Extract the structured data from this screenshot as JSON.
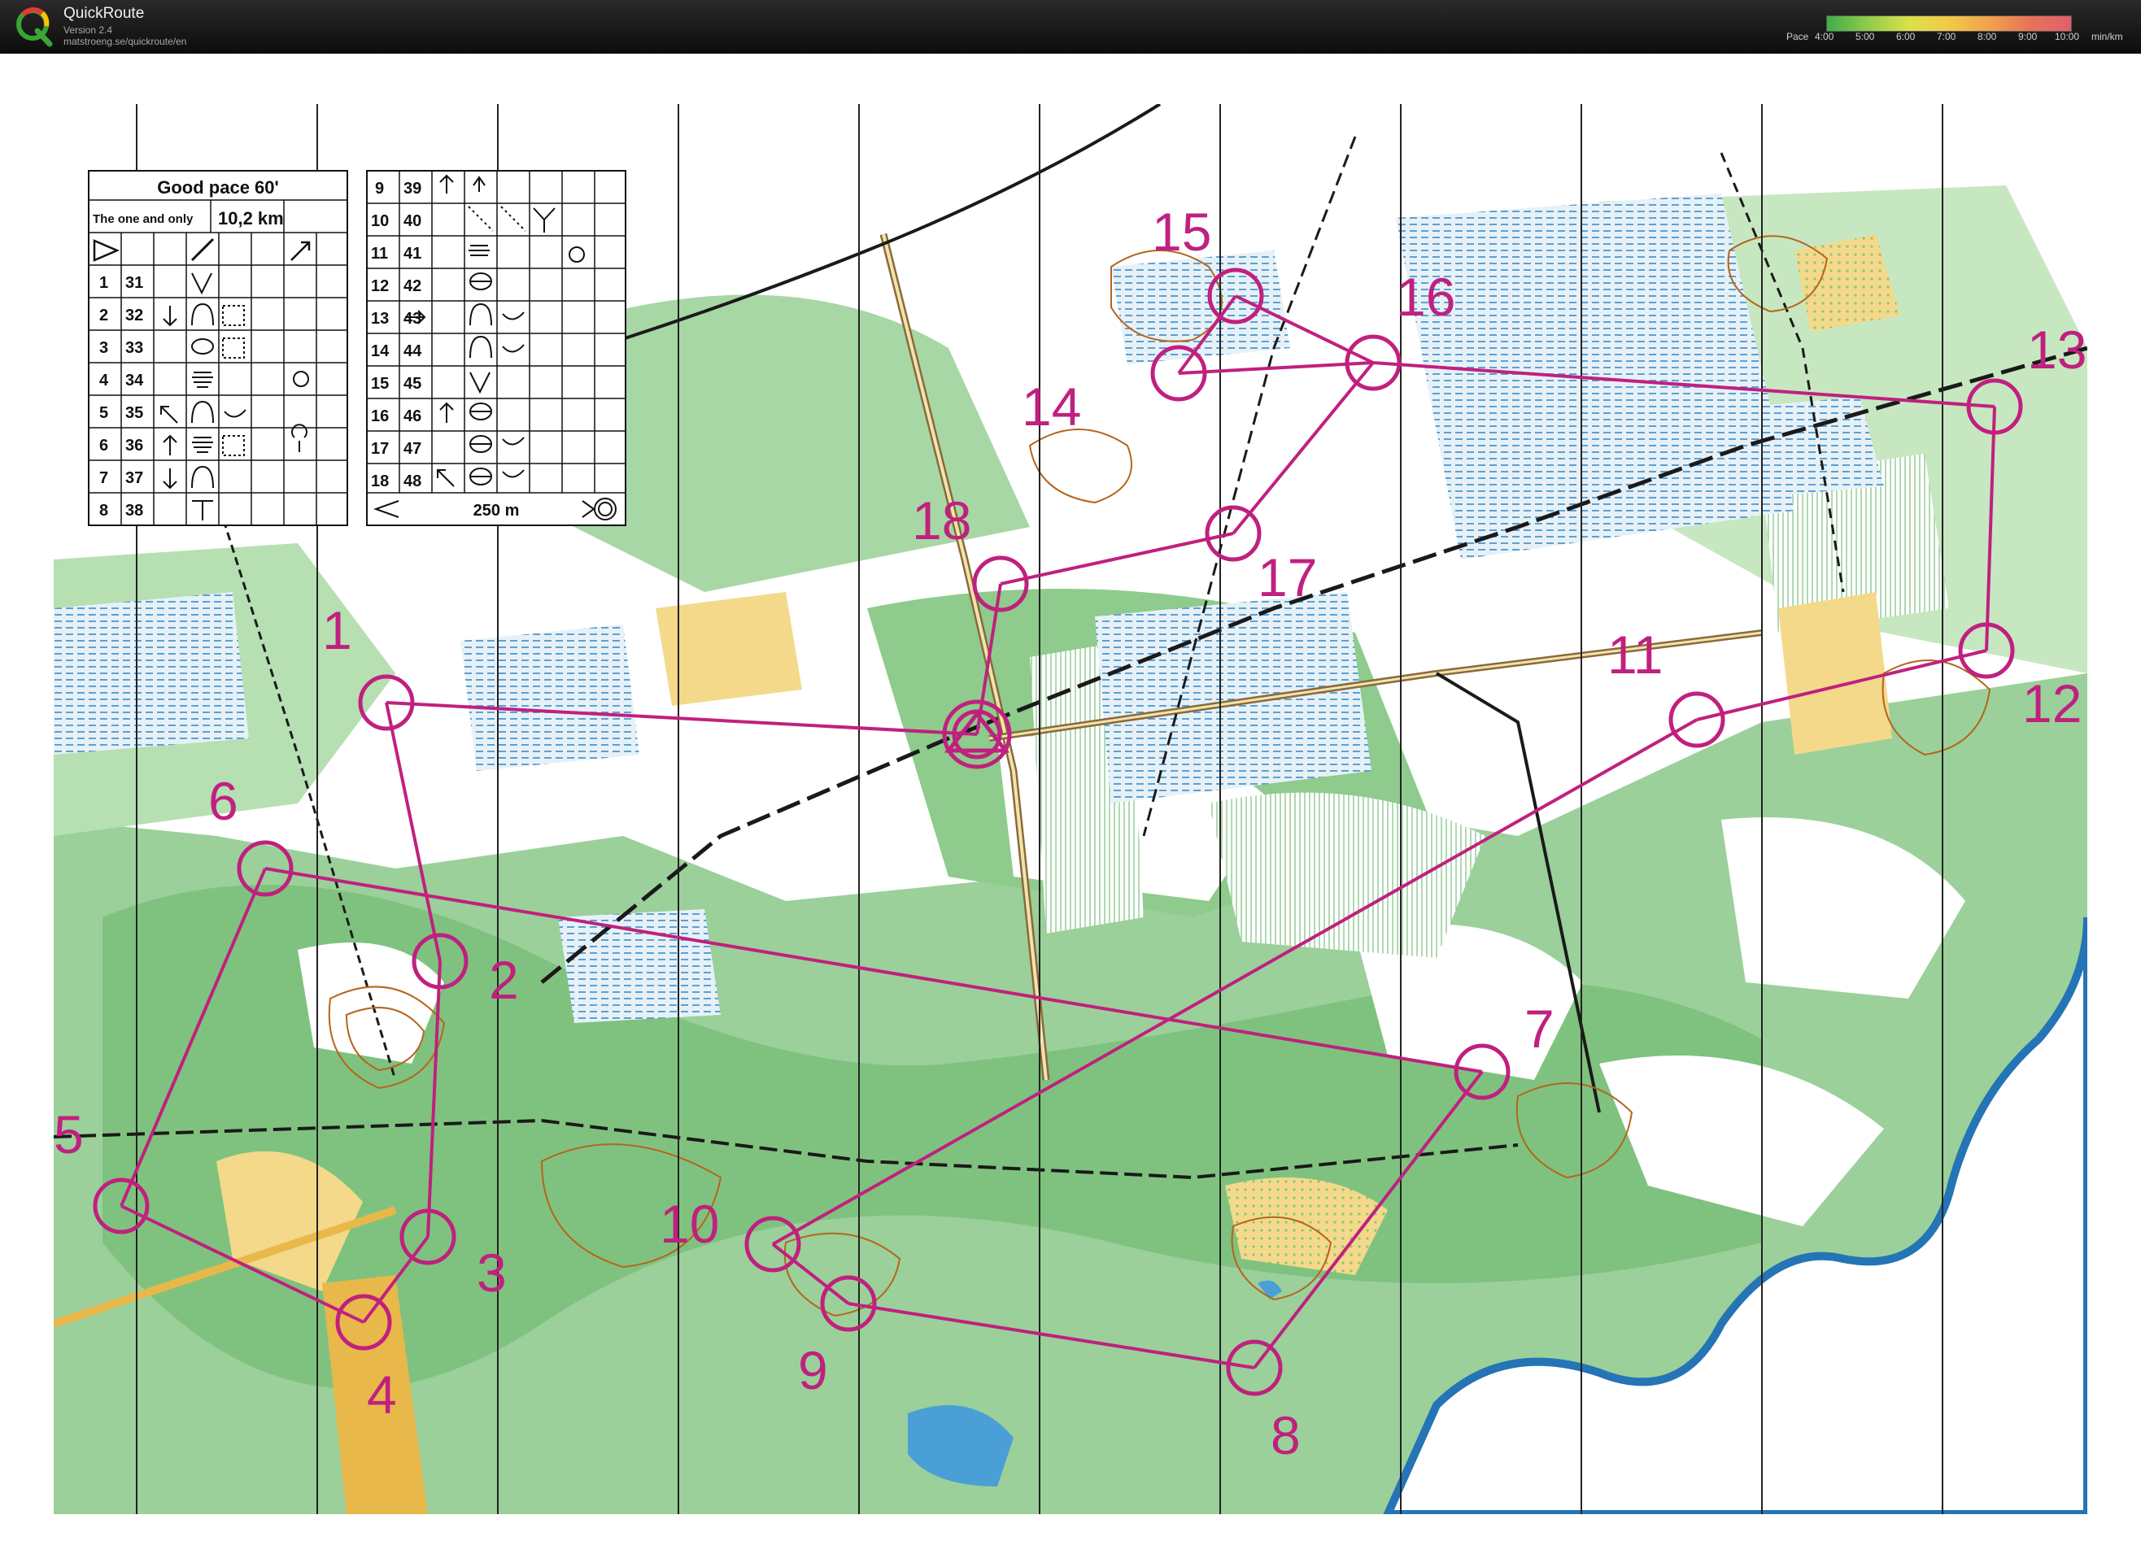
{
  "app": {
    "title": "QuickRoute",
    "version": "Version 2.4",
    "url": "matstroeng.se/quickroute/en"
  },
  "pace_legend": {
    "label": "Pace",
    "ticks": [
      "4:00",
      "5:00",
      "6:00",
      "7:00",
      "8:00",
      "9:00",
      "10:00"
    ],
    "unit": "min/km",
    "colors": [
      "#3fae49",
      "#8fcb4a",
      "#d9e24a",
      "#f2c94a",
      "#f0a24a",
      "#e8725a",
      "#e0606a"
    ]
  },
  "map": {
    "course_color": "#c0207f",
    "description_sheet": {
      "event_title": "Good pace 60'",
      "class_name": "The one and only",
      "course_length": "10,2 km",
      "left_rows": [
        {
          "num": "1",
          "code": "31"
        },
        {
          "num": "2",
          "code": "32"
        },
        {
          "num": "3",
          "code": "33"
        },
        {
          "num": "4",
          "code": "34"
        },
        {
          "num": "5",
          "code": "35"
        },
        {
          "num": "6",
          "code": "36"
        },
        {
          "num": "7",
          "code": "37"
        },
        {
          "num": "8",
          "code": "38"
        }
      ],
      "right_rows": [
        {
          "num": "9",
          "code": "39"
        },
        {
          "num": "10",
          "code": "40"
        },
        {
          "num": "11",
          "code": "41"
        },
        {
          "num": "12",
          "code": "42"
        },
        {
          "num": "13",
          "code": "43"
        },
        {
          "num": "14",
          "code": "44"
        },
        {
          "num": "15",
          "code": "45"
        },
        {
          "num": "16",
          "code": "46"
        },
        {
          "num": "17",
          "code": "47"
        },
        {
          "num": "18",
          "code": "48"
        }
      ],
      "finish_distance": "250 m"
    },
    "controls": [
      {
        "number": "1"
      },
      {
        "number": "2"
      },
      {
        "number": "3"
      },
      {
        "number": "4"
      },
      {
        "number": "5"
      },
      {
        "number": "6"
      },
      {
        "number": "7"
      },
      {
        "number": "8"
      },
      {
        "number": "9"
      },
      {
        "number": "10"
      },
      {
        "number": "11"
      },
      {
        "number": "12"
      },
      {
        "number": "13"
      },
      {
        "number": "14"
      },
      {
        "number": "15"
      },
      {
        "number": "16"
      },
      {
        "number": "17"
      },
      {
        "number": "18"
      }
    ],
    "symbols": [
      "start-triangle",
      "finish-double-circle",
      "control-circle",
      "water-lake",
      "forest-green",
      "open-land-yellow",
      "marsh-blue",
      "road-black",
      "contour-brown"
    ]
  }
}
